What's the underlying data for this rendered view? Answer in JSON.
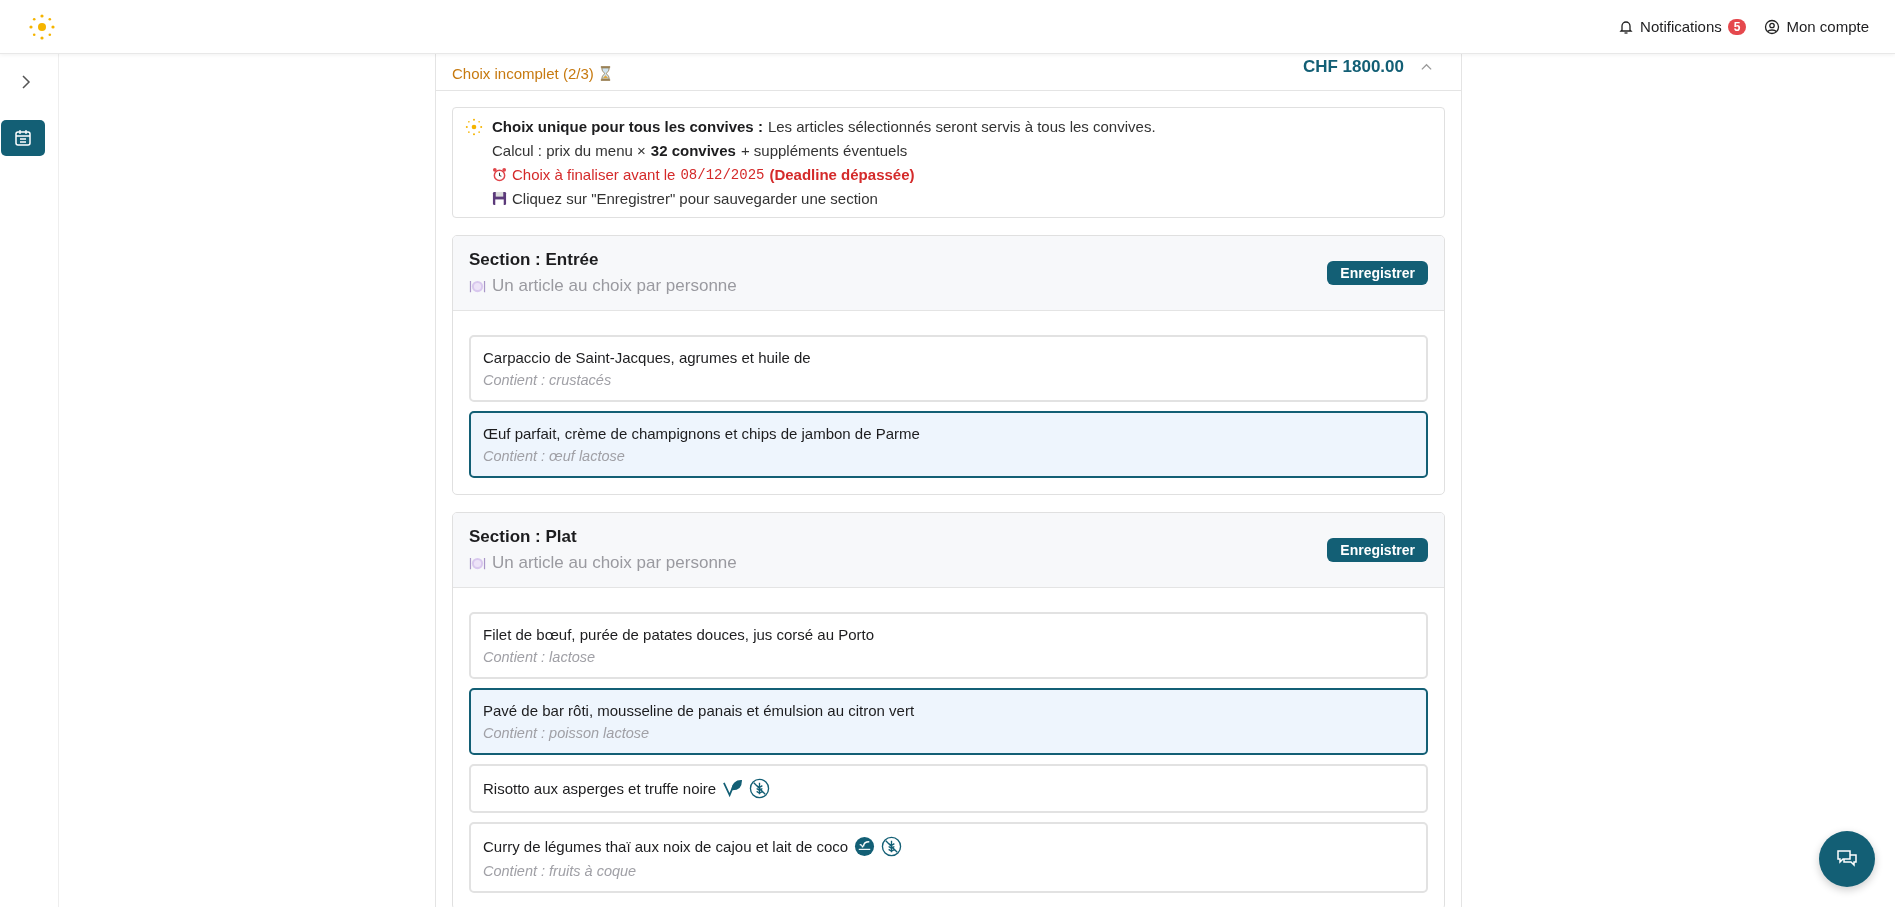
{
  "header": {
    "notifications": {
      "label": "Notifications",
      "count": "5"
    },
    "account": {
      "label": "Mon compte"
    }
  },
  "menu_card": {
    "status": "Choix incomplet (2/3)",
    "price": "CHF 1800.00",
    "info": {
      "title": "Choix unique pour tous les convives :",
      "text": "Les articles sélectionnés seront servis à tous les convives.",
      "calc": "Calcul : prix du menu × **32 convives** + suppléments éventuels",
      "deadline_label": "Choix à finaliser avant le",
      "deadline_date": "08/12/2025",
      "deadline_note": "(Deadline dépassée)",
      "save_hint": "Cliquez sur \"Enregistrer\" pour sauvegarder une section"
    },
    "sections": [
      {
        "title": "Section : Entrée",
        "subtitle": "Un article au choix par personne",
        "button": "Enregistrer",
        "items": [
          {
            "name": "Carpaccio de Saint-Jacques, agrumes et huile de",
            "allergens": "Contient : crustacés",
            "selected": false
          },
          {
            "name": "Œuf parfait, crème de champignons et chips de jambon de Parme",
            "allergens": "Contient : œuf lactose",
            "selected": true
          }
        ]
      },
      {
        "title": "Section : Plat",
        "subtitle": "Un article au choix par personne",
        "button": "Enregistrer",
        "items": [
          {
            "name": "Filet de bœuf, purée de patates douces, jus corsé au Porto",
            "allergens": "Contient : lactose",
            "selected": false
          },
          {
            "name": "Pavé de bar rôti, mousseline de panais et émulsion au citron vert",
            "allergens": "Contient : poisson lactose",
            "selected": true
          },
          {
            "name": "Risotto aux asperges et truffe noire",
            "selected": false,
            "tags": [
              {
                "kind": "vegan"
              },
              {
                "kind": "gluten_free"
              }
            ]
          },
          {
            "name": "Curry de légumes thaï aux noix de cajou et lait de coco",
            "allergens": "Contient : fruits à coque",
            "selected": false,
            "tags": [
              {
                "kind": "vegan_badge"
              },
              {
                "kind": "gluten_free"
              }
            ]
          }
        ]
      }
    ]
  }
}
